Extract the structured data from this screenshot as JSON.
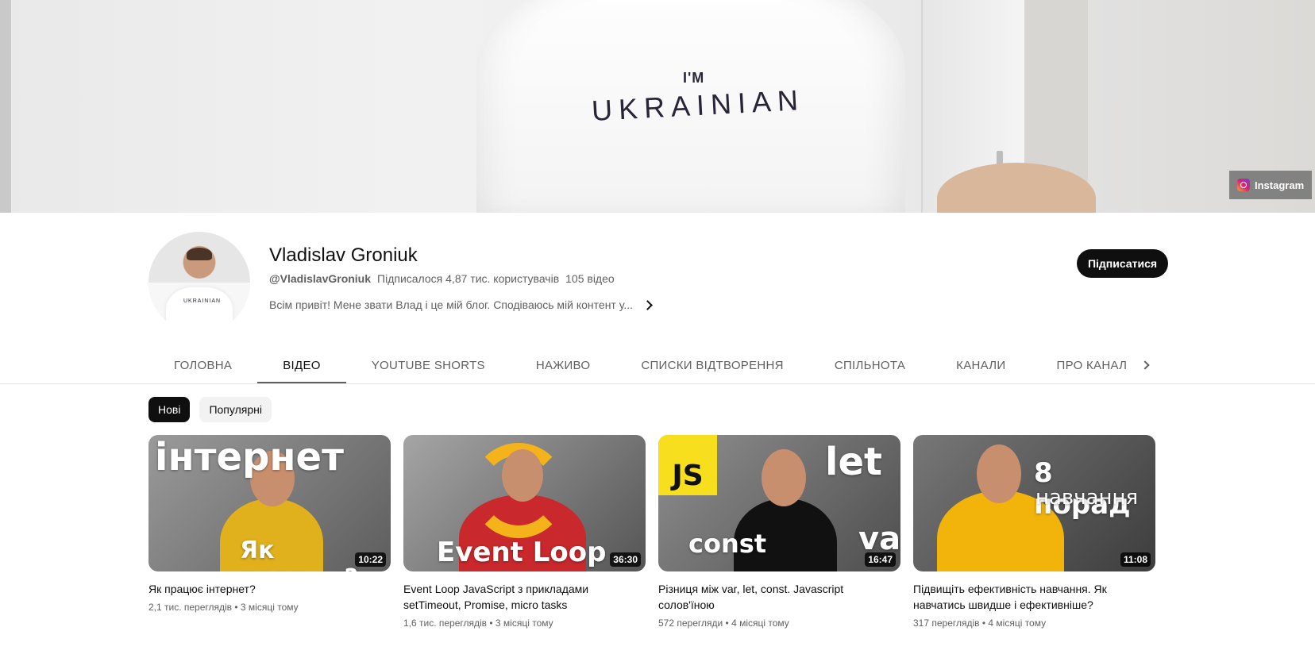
{
  "banner": {
    "shirt_small": "I'M",
    "shirt_big": "UKRAINIAN",
    "link_label": "Instagram"
  },
  "channel": {
    "avatar_text": "UKRAINIAN",
    "name": "Vladislav Groniuk",
    "handle": "@VladislavGroniuk",
    "subscribers": "Підписалося 4,87 тис. користувачів",
    "videos_count": "105 відео",
    "description": "Всім привіт! Мене звати Влад і це мій блог. Сподіваюсь мій контент у...",
    "subscribe_label": "Підписатися"
  },
  "tabs": [
    "ГОЛОВНА",
    "ВІДЕО",
    "YOUTUBE SHORTS",
    "НАЖИВО",
    "СПИСКИ ВІДТВОРЕННЯ",
    "СПІЛЬНОТА",
    "КАНАЛИ",
    "ПРО КАНАЛ"
  ],
  "active_tab": "ВІДЕО",
  "chips": [
    "Нові",
    "Популярні"
  ],
  "videos": [
    {
      "thumb_text": [
        "інтернет",
        "Як працює?"
      ],
      "duration": "10:22",
      "title": "Як працює інтернет?",
      "meta": "2,1 тис. переглядів • 3 місяці тому"
    },
    {
      "thumb_text": [
        "Event Loop"
      ],
      "duration": "36:30",
      "title": "Event Loop JavaScript з прикладами setTimeout, Promise, micro tasks",
      "meta": "1,6 тис. переглядів • 3 місяці тому"
    },
    {
      "thumb_text": [
        "JS",
        "let",
        "const",
        "var"
      ],
      "duration": "16:47",
      "title": "Різниця між var, let, const. Javascript солов'їною",
      "meta": "572 перегляди • 4 місяці тому"
    },
    {
      "thumb_text": [
        "8 порад",
        "навчання"
      ],
      "duration": "11:08",
      "title": "Підвищіть ефективність навчання. Як навчатись швидше і ефективніше?",
      "meta": "317 переглядів • 4 місяці тому"
    }
  ],
  "colors": {
    "subscribe_bg": "#0f0f0f",
    "active_chip_bg": "#0f0f0f",
    "chip_bg": "#f2f2f2",
    "meta_text": "#606060"
  }
}
